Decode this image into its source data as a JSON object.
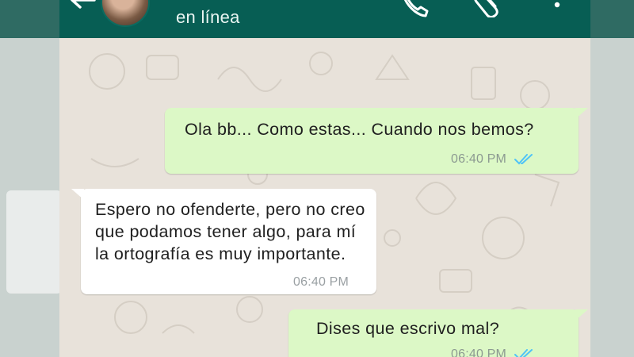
{
  "header": {
    "status": "en línea",
    "icons": [
      "back-arrow-icon",
      "avatar",
      "phone-icon",
      "paperclip-icon",
      "more-vert-icon"
    ],
    "color": "#075e54"
  },
  "messages": [
    {
      "direction": "outgoing",
      "text": "Ola bb... Como estas... Cuando nos bemos?",
      "time": "06:40 PM",
      "status_icon": "double-check-icon"
    },
    {
      "direction": "incoming",
      "text": "Espero no ofenderte, pero no creo que podamos tener algo, para mí la ortografía es muy importante.",
      "time": "06:40 PM"
    },
    {
      "direction": "outgoing",
      "text": "Dises que escrivo mal?",
      "time": "06:40 PM",
      "status_icon": "double-check-icon"
    }
  ],
  "colors": {
    "outgoing_bubble": "#dcf8c6",
    "incoming_bubble": "#ffffff",
    "read_ticks": "#4fc3f7"
  }
}
